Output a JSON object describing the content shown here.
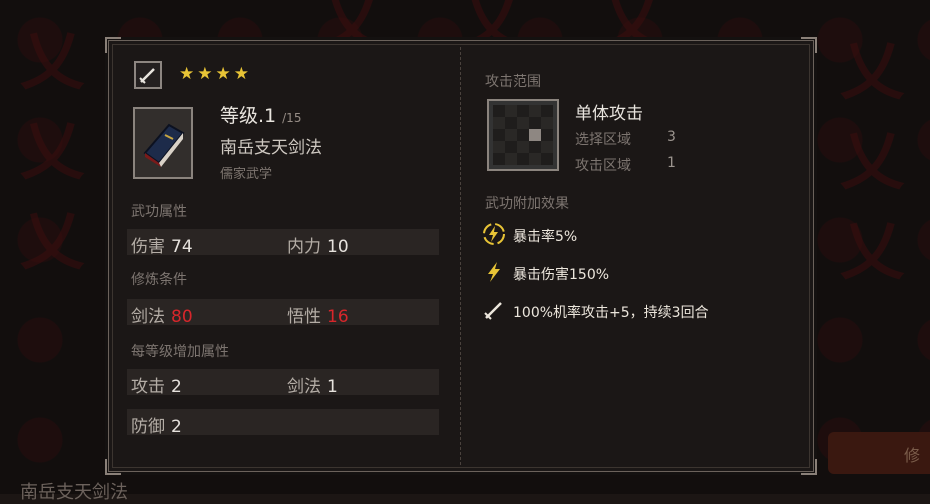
{
  "background": {
    "bottom_text": "南岳支天剑法",
    "right_button": "修"
  },
  "skill": {
    "stars": 4,
    "level_label": "等级.1",
    "level_max": "/15",
    "name": "南岳支天剑法",
    "school": "儒家武学"
  },
  "attributes": {
    "title": "武功属性",
    "damage_label": "伤害",
    "damage_value": "74",
    "neili_label": "内力",
    "neili_value": "10"
  },
  "requirements": {
    "title": "修炼条件",
    "sword_label": "剑法",
    "sword_value": "80",
    "insight_label": "悟性",
    "insight_value": "16"
  },
  "per_level": {
    "title": "每等级增加属性",
    "attack_label": "攻击",
    "attack_value": "2",
    "sword_label": "剑法",
    "sword_value": "1",
    "defense_label": "防御",
    "defense_value": "2"
  },
  "range": {
    "title": "攻击范围",
    "type": "单体攻击",
    "select_label": "选择区域",
    "select_value": "3",
    "attack_label": "攻击区域",
    "attack_value": "1"
  },
  "effects": {
    "title": "武功附加效果",
    "items": [
      {
        "icon": "lightning-circle-icon",
        "text": "暴击率5%"
      },
      {
        "icon": "lightning-icon",
        "text": "暴击伤害150%"
      },
      {
        "icon": "sword-icon",
        "text": "100%机率攻击+5，持续3回合"
      }
    ]
  },
  "colors": {
    "accent_yellow": "#e8c436",
    "requirement_red": "#d7262b"
  }
}
